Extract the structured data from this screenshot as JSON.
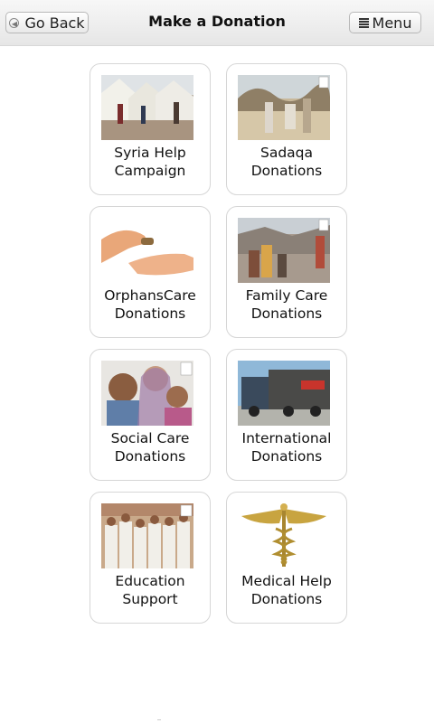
{
  "header": {
    "back_label": "Go Back",
    "title": "Make a Donation",
    "menu_label": "Menu"
  },
  "cards": [
    {
      "line1": "Syria Help",
      "line2": "Campaign",
      "image": "refugee-tents-image"
    },
    {
      "line1": "Sadaqa",
      "line2": "Donations",
      "image": "people-in-desert-image"
    },
    {
      "line1": "OrphansCare",
      "line2": "Donations",
      "image": "hands-giving-coin-image"
    },
    {
      "line1": "Family Care",
      "line2": "Donations",
      "image": "family-in-rubble-image"
    },
    {
      "line1": "Social Care",
      "line2": "Donations",
      "image": "children-portrait-image"
    },
    {
      "line1": "International",
      "line2": "Donations",
      "image": "aid-truck-image"
    },
    {
      "line1": "Education",
      "line2": "Support",
      "image": "students-group-image"
    },
    {
      "line1": "Medical Help",
      "line2": "Donations",
      "image": "caduceus-icon"
    }
  ]
}
